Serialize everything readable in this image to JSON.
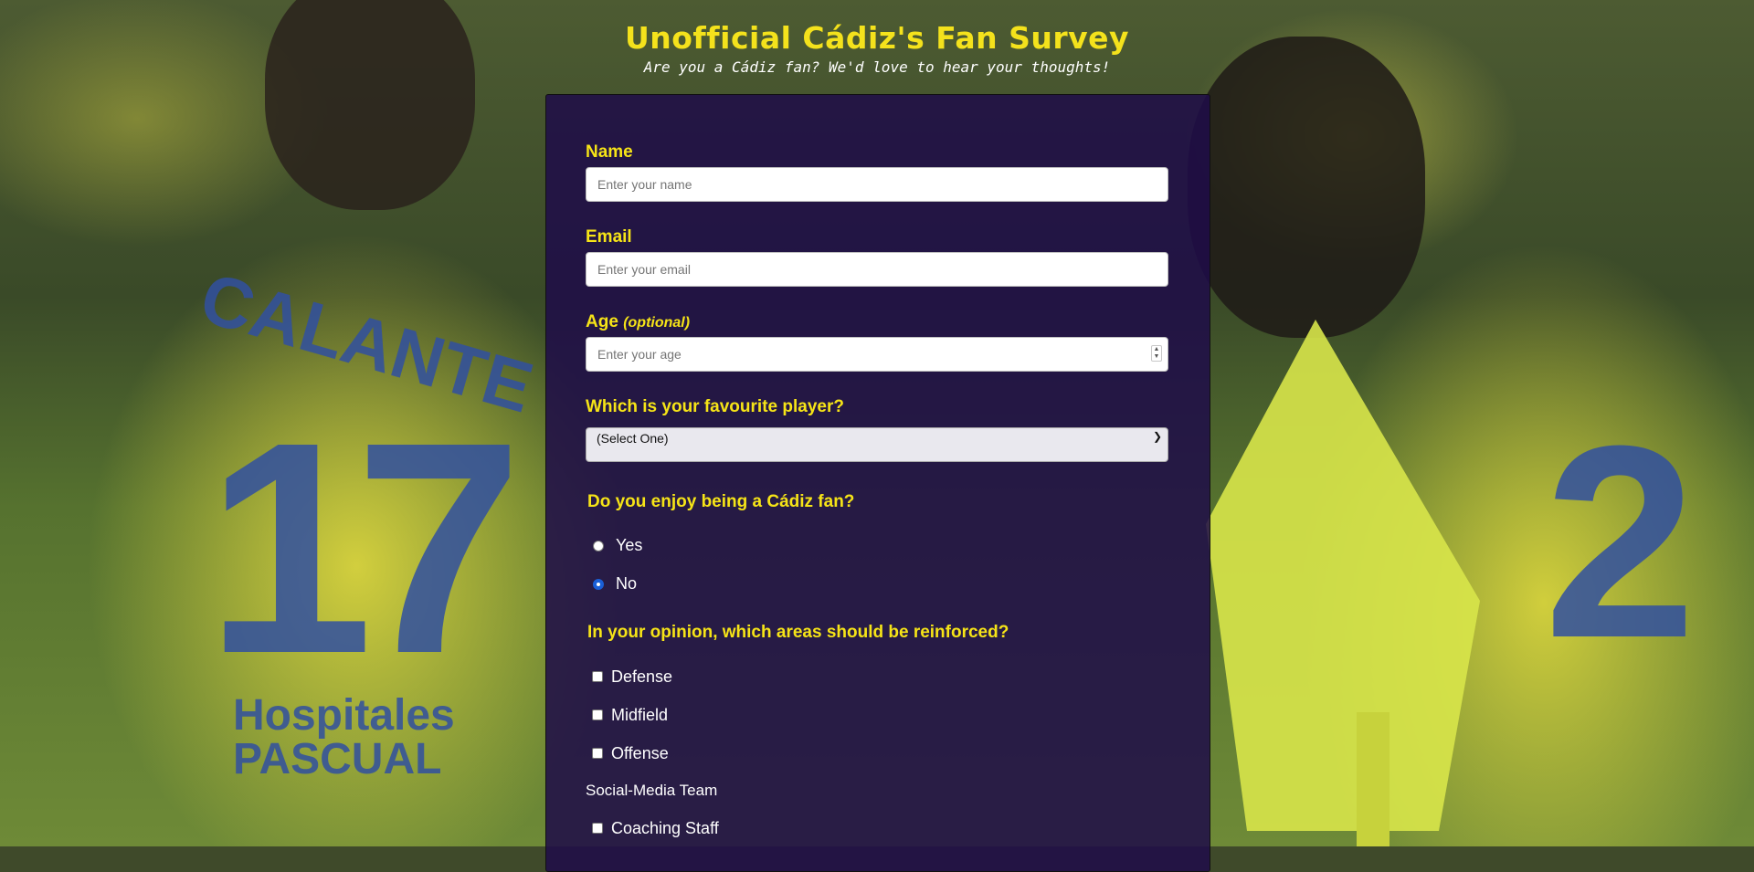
{
  "header": {
    "title": "Unofficial Cádiz's Fan Survey",
    "subtitle": "Are you a Cádiz fan? We'd love to hear your thoughts!"
  },
  "background": {
    "jersey_left_name": "CALANTE",
    "jersey_left_number": "17",
    "jersey_left_sponsor_line1": "Hospitales",
    "jersey_left_sponsor_line2": "PASCUAL",
    "jersey_right_number": "2"
  },
  "form": {
    "name": {
      "label": "Name",
      "placeholder": "Enter your name"
    },
    "email": {
      "label": "Email",
      "placeholder": "Enter your email"
    },
    "age": {
      "label": "Age",
      "optional_note": "(optional)",
      "placeholder": "Enter your age"
    },
    "player": {
      "label": "Which is your favourite player?",
      "selected": "(Select One)"
    },
    "enjoy": {
      "label": "Do you enjoy being a Cádiz fan?",
      "options": [
        {
          "label": "Yes",
          "checked": false
        },
        {
          "label": "No",
          "checked": true
        }
      ]
    },
    "reinforce": {
      "label": "In your opinion, which areas should be reinforced?",
      "options": [
        {
          "label": "Defense",
          "checked": false
        },
        {
          "label": "Midfield",
          "checked": false
        },
        {
          "label": "Offense",
          "checked": false
        }
      ],
      "social_media": "Social-Media Team",
      "coaching": {
        "label": "Coaching Staff",
        "checked": false
      }
    }
  },
  "colors": {
    "accent": "#f6e417",
    "card_bg": "#1e0c48",
    "radio_selected": "#1a5fd6"
  }
}
